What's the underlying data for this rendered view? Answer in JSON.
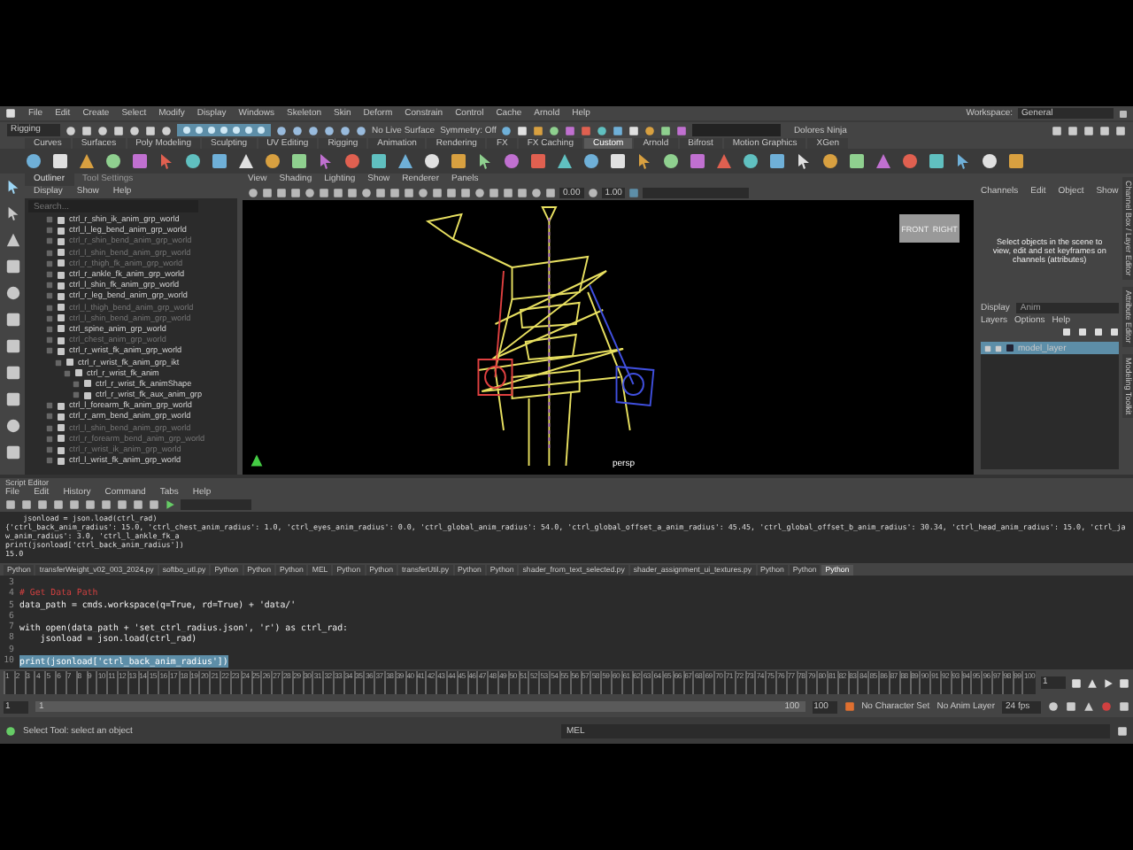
{
  "menubar": {
    "items": [
      "File",
      "Edit",
      "Create",
      "Select",
      "Modify",
      "Display",
      "Windows",
      "Skeleton",
      "Skin",
      "Deform",
      "Constrain",
      "Control",
      "Cache",
      "Arnold",
      "Help"
    ],
    "workspace_label": "Workspace:",
    "workspace": "General"
  },
  "status_line": {
    "menu_set": "Rigging",
    "live_surface": "No Live Surface",
    "symmetry": "Symmetry: Off",
    "account": "Dolores Ninja"
  },
  "shelf": {
    "tabs": [
      {
        "label": "Curves",
        "selected": false
      },
      {
        "label": "Surfaces",
        "selected": false
      },
      {
        "label": "Poly Modeling",
        "selected": false
      },
      {
        "label": "Sculpting",
        "selected": false
      },
      {
        "label": "UV Editing",
        "selected": false
      },
      {
        "label": "Rigging",
        "selected": false
      },
      {
        "label": "Animation",
        "selected": false
      },
      {
        "label": "Rendering",
        "selected": false
      },
      {
        "label": "FX",
        "selected": false
      },
      {
        "label": "FX Caching",
        "selected": false
      },
      {
        "label": "Custom",
        "selected": true
      },
      {
        "label": "Arnold",
        "selected": false
      },
      {
        "label": "Bifrost",
        "selected": false
      },
      {
        "label": "Motion Graphics",
        "selected": false
      },
      {
        "label": "XGen",
        "selected": false
      }
    ]
  },
  "outliner": {
    "tabs": [
      {
        "label": "Outliner",
        "selected": true
      },
      {
        "label": "Tool Settings",
        "selected": false
      }
    ],
    "menu": [
      "Display",
      "Show",
      "Help"
    ],
    "search_placeholder": "Search...",
    "items": [
      {
        "label": "ctrl_r_shin_ik_anim_grp_world",
        "hidden": false
      },
      {
        "label": "ctrl_l_leg_bend_anim_grp_world",
        "hidden": false
      },
      {
        "label": "ctrl_r_shin_bend_anim_grp_world",
        "hidden": true
      },
      {
        "label": "ctrl_l_shin_bend_anim_grp_world",
        "hidden": true
      },
      {
        "label": "ctrl_r_thigh_fk_anim_grp_world",
        "hidden": true
      },
      {
        "label": "ctrl_r_ankle_fk_anim_grp_world",
        "hidden": false
      },
      {
        "label": "ctrl_l_shin_fk_anim_grp_world",
        "hidden": false
      },
      {
        "label": "ctrl_r_leg_bend_anim_grp_world",
        "hidden": false
      },
      {
        "label": "ctrl_l_thigh_bend_anim_grp_world",
        "hidden": true
      },
      {
        "label": "ctrl_l_shin_bend_anim_grp_world",
        "hidden": true
      },
      {
        "label": "ctrl_spine_anim_grp_world",
        "hidden": false
      },
      {
        "label": "ctrl_chest_anim_grp_world",
        "hidden": true
      },
      {
        "label": "ctrl_r_wrist_fk_anim_grp_world",
        "hidden": false,
        "children": [
          {
            "label": "ctrl_r_wrist_fk_anim_grp_ikt",
            "hidden": false,
            "children": [
              {
                "label": "ctrl_r_wrist_fk_anim",
                "hidden": false,
                "children": [
                  {
                    "label": "ctrl_r_wrist_fk_animShape",
                    "hidden": false
                  },
                  {
                    "label": "ctrl_r_wrist_fk_aux_anim_grp",
                    "hidden": false
                  }
                ]
              }
            ]
          }
        ]
      },
      {
        "label": "ctrl_l_forearm_fk_anim_grp_world",
        "hidden": false
      },
      {
        "label": "ctrl_r_arm_bend_anim_grp_world",
        "hidden": false
      },
      {
        "label": "ctrl_l_shin_bend_anim_grp_world",
        "hidden": true
      },
      {
        "label": "ctrl_r_forearm_bend_anim_grp_world",
        "hidden": true
      },
      {
        "label": "ctrl_r_wrist_ik_anim_grp_world",
        "hidden": true
      },
      {
        "label": "ctrl_l_wrist_fk_anim_grp_world",
        "hidden": false
      }
    ]
  },
  "viewport": {
    "menu": [
      "View",
      "Shading",
      "Lighting",
      "Show",
      "Renderer",
      "Panels"
    ],
    "exposure": "0.00",
    "gamma": "1.00",
    "camera": "persp",
    "cube_faces": [
      "FRONT",
      "RIGHT"
    ]
  },
  "channel_box": {
    "menu": [
      "Channels",
      "Edit",
      "Object",
      "Show"
    ],
    "message": "Select objects in the scene to view, edit and set keyframes on channels (attributes)",
    "display_label": "Display",
    "display_value": "Anim",
    "layer_menu": [
      "Layers",
      "Options",
      "Help"
    ],
    "layers": [
      {
        "name": "model_layer",
        "selected": true
      }
    ],
    "side_tabs": [
      "Channel Box / Layer Editor",
      "Attribute Editor",
      "Modeling Toolkit"
    ]
  },
  "script_editor": {
    "title": "Script Editor",
    "menu": [
      "File",
      "Edit",
      "History",
      "Command",
      "Tabs",
      "Help"
    ],
    "output": [
      "    jsonload = json.load(ctrl_rad)",
      "{'ctrl_back_anim_radius': 15.0, 'ctrl_chest_anim_radius': 1.0, 'ctrl_eyes_anim_radius': 0.0, 'ctrl_global_anim_radius': 54.0, 'ctrl_global_offset_a_anim_radius': 45.45, 'ctrl_global_offset_b_anim_radius': 30.34, 'ctrl_head_anim_radius': 15.0, 'ctrl_jaw_anim_radius': 3.0, 'ctrl_l_ankle_fk_a",
      "print(jsonload['ctrl_back_anim_radius'])",
      "15.0"
    ],
    "tabs": [
      {
        "label": "Python",
        "selected": false
      },
      {
        "label": "transferWeight_v02_003_2024.py",
        "selected": false
      },
      {
        "label": "softbo_utl.py",
        "selected": false
      },
      {
        "label": "Python",
        "selected": false
      },
      {
        "label": "Python",
        "selected": false
      },
      {
        "label": "Python",
        "selected": false
      },
      {
        "label": "MEL",
        "selected": false
      },
      {
        "label": "Python",
        "selected": false
      },
      {
        "label": "Python",
        "selected": false
      },
      {
        "label": "transferUtil.py",
        "selected": false
      },
      {
        "label": "Python",
        "selected": false
      },
      {
        "label": "Python",
        "selected": false
      },
      {
        "label": "shader_from_text_selected.py",
        "selected": false
      },
      {
        "label": "shader_assignment_ui_textures.py",
        "selected": false
      },
      {
        "label": "Python",
        "selected": false
      },
      {
        "label": "Python",
        "selected": false
      },
      {
        "label": "Python",
        "selected": true
      }
    ],
    "code": [
      {
        "number": "3",
        "kind": "blank"
      },
      {
        "number": "4",
        "text": "# Get Data Path",
        "kind": "comment",
        "selected": false
      },
      {
        "number": "5",
        "text": "data_path = cmds.workspace(q=True, rd=True) + 'data/'",
        "kind": "code",
        "selected": false
      },
      {
        "number": "6",
        "kind": "blank"
      },
      {
        "number": "7",
        "text": "with open(data_path + 'set_ctrl_radius.json', 'r') as ctrl_rad:",
        "kind": "code",
        "selected": false
      },
      {
        "number": "8",
        "text": "    jsonload = json.load(ctrl_rad)",
        "kind": "code",
        "selected": false
      },
      {
        "number": "9",
        "kind": "blank"
      },
      {
        "number": "10",
        "text": "print(jsonload['ctrl_back_anim_radius'])",
        "kind": "code",
        "selected": true
      }
    ]
  },
  "timeline": {
    "ticks": [
      "1",
      "2",
      "3",
      "4",
      "5",
      "6",
      "7",
      "8",
      "9",
      "10",
      "11",
      "12",
      "13",
      "14",
      "15",
      "16",
      "17",
      "18",
      "19",
      "20",
      "21",
      "22",
      "23",
      "24",
      "25",
      "26",
      "27",
      "28",
      "29",
      "30",
      "31",
      "32",
      "33",
      "34",
      "35",
      "36",
      "37",
      "38",
      "39",
      "40",
      "41",
      "42",
      "43",
      "44",
      "45",
      "46",
      "47",
      "48",
      "49",
      "50",
      "51",
      "52",
      "53",
      "54",
      "55",
      "56",
      "57",
      "58",
      "59",
      "60",
      "61",
      "62",
      "63",
      "64",
      "65",
      "66",
      "67",
      "68",
      "69",
      "70",
      "71",
      "72",
      "73",
      "74",
      "75",
      "76",
      "77",
      "78",
      "79",
      "80",
      "81",
      "82",
      "83",
      "84",
      "85",
      "86",
      "87",
      "88",
      "89",
      "90",
      "91",
      "92",
      "93",
      "94",
      "95",
      "96",
      "97",
      "98",
      "99",
      "100"
    ],
    "current_frame": "1"
  },
  "range": {
    "level": 1,
    "start": "1",
    "range_start": "1",
    "range_end": "100",
    "end": "100",
    "character_set": "No Character Set",
    "anim_layer": "No Anim Layer",
    "fps": "24 fps"
  },
  "help_line": {
    "text": "Select Tool: select an object",
    "command_lang": "MEL"
  }
}
